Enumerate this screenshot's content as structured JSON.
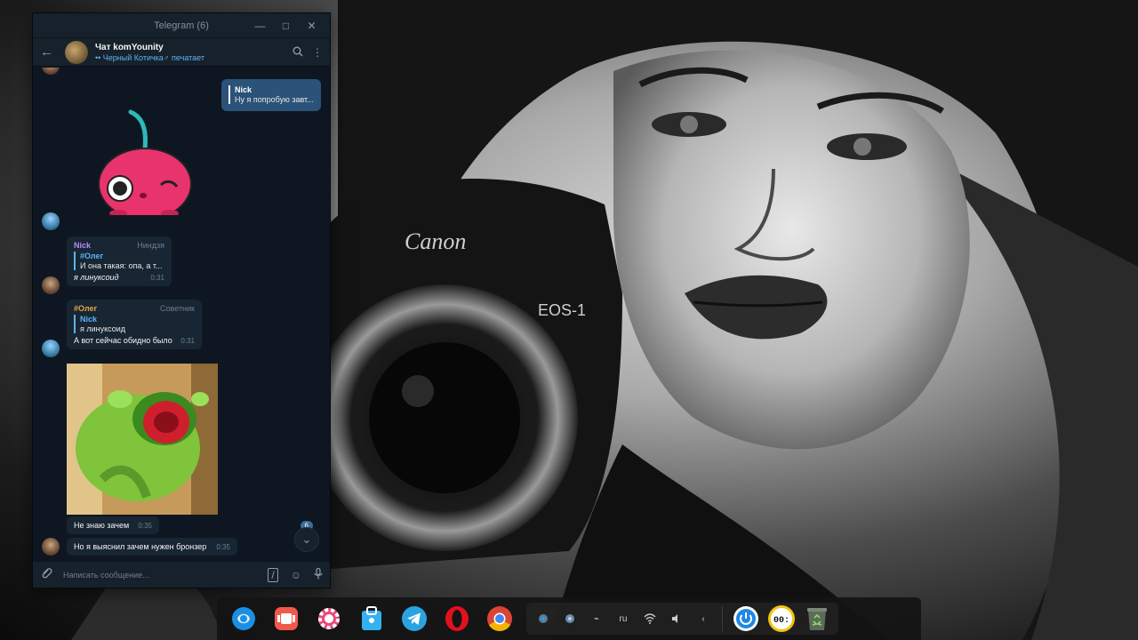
{
  "window": {
    "title": "Telegram (6)",
    "controls": {
      "minimize": "—",
      "maximize": "□",
      "close": "✕"
    }
  },
  "chat": {
    "name": "Чат komYounity",
    "status": "•• Черный Котичка♂ печатает"
  },
  "messages": {
    "outgoing_reply": {
      "name": "Nick",
      "text": "Ну я попробую завт..."
    },
    "msg1": {
      "sender": "Nick",
      "role": "Ниндзя",
      "reply_name": "#Олег",
      "reply_text": "И она такая: опа, а т...",
      "text": "я линуксоид",
      "time": "0:31"
    },
    "msg2": {
      "sender": "#Олег",
      "role": "Советник",
      "reply_name": "Nick",
      "reply_text": "я линуксоид",
      "text": "А вот сейчас обидно было",
      "time": "0:31"
    },
    "msg3": {
      "text": "Не знаю зачем",
      "time": "0:35"
    },
    "msg4": {
      "text": "Но я выяснил зачем нужен бронзер",
      "time": "0:35"
    }
  },
  "unread_count": "6",
  "composer": {
    "placeholder": "Написать сообщение..."
  },
  "dock": {
    "tray": {
      "keyboard_layout": "ru"
    }
  },
  "colors": {
    "window_bg": "#0e1621",
    "header_bg": "#17212b",
    "bubble_in": "#182533",
    "bubble_out": "#2b5278",
    "accent": "#5bb3f5",
    "name_nick": "#b28df5",
    "name_oleg": "#e8a547"
  }
}
